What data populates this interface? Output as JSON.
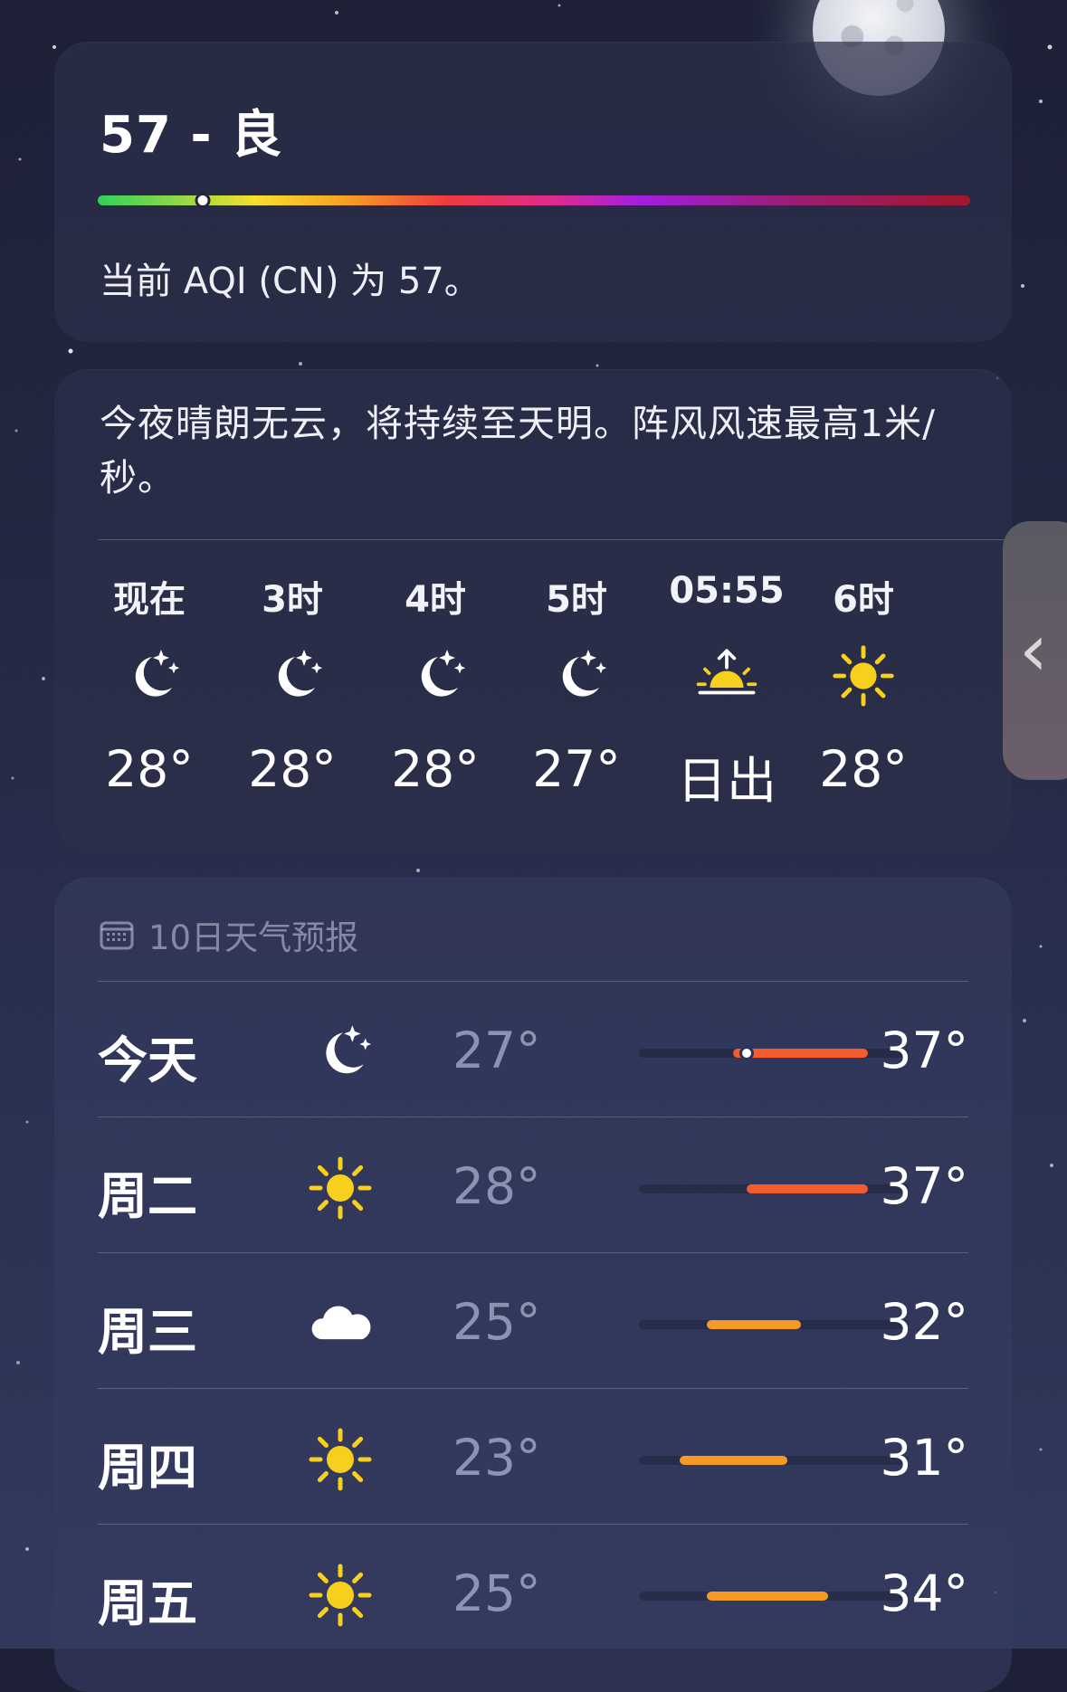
{
  "aqi": {
    "title": "57 - 良",
    "description": "当前 AQI (CN) 为 57。",
    "index_fraction": 0.12
  },
  "hourly": {
    "summary": "今夜晴朗无云，将持续至天明。阵风风速最高1米/秒。",
    "items": [
      {
        "label": "现在",
        "icon": "moon-stars-icon",
        "value": "28°"
      },
      {
        "label": "3时",
        "icon": "moon-stars-icon",
        "value": "28°"
      },
      {
        "label": "4时",
        "icon": "moon-stars-icon",
        "value": "28°"
      },
      {
        "label": "5时",
        "icon": "moon-stars-icon",
        "value": "27°"
      },
      {
        "label": "05:55",
        "icon": "sunrise-icon",
        "value": "日出"
      },
      {
        "label": "6时",
        "icon": "sun-icon",
        "value": "28°"
      }
    ]
  },
  "forecast": {
    "title": "10日天气预报",
    "range_min": 20,
    "range_max": 40,
    "days": [
      {
        "day": "今天",
        "icon": "moon-stars-icon",
        "low": "27°",
        "high": "37°",
        "low_value": 27,
        "high_value": 37,
        "current_value": 28
      },
      {
        "day": "周二",
        "icon": "sun-icon",
        "low": "28°",
        "high": "37°",
        "low_value": 28,
        "high_value": 37
      },
      {
        "day": "周三",
        "icon": "cloud-icon",
        "low": "25°",
        "high": "32°",
        "low_value": 25,
        "high_value": 32
      },
      {
        "day": "周四",
        "icon": "sun-icon",
        "low": "23°",
        "high": "31°",
        "low_value": 23,
        "high_value": 31
      },
      {
        "day": "周五",
        "icon": "sun-icon",
        "low": "25°",
        "high": "34°",
        "low_value": 25,
        "high_value": 34
      }
    ]
  },
  "colors": {
    "hot": "#f25c2f",
    "warm": "#f79a24",
    "icon_yellow": "#f7cf1d"
  }
}
